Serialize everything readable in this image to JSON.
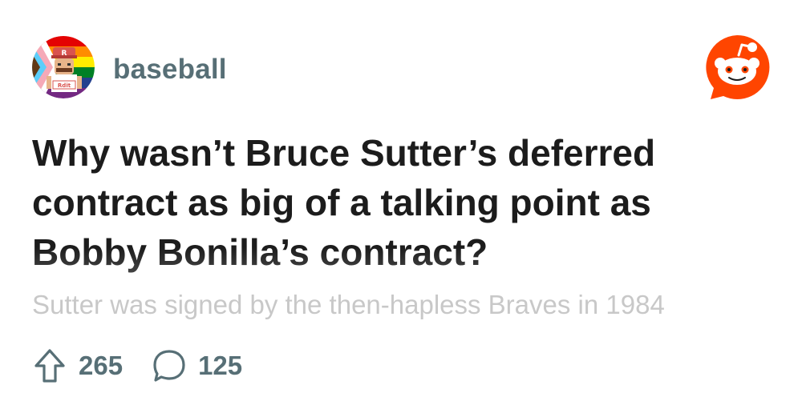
{
  "subreddit": {
    "name": "baseball",
    "avatar_icon": "subreddit-avatar-icon",
    "avatar_text": "Rdit"
  },
  "brand": {
    "logo_icon": "reddit-logo-icon",
    "accent_color": "#ff4500"
  },
  "post": {
    "title_lines": [
      "Why wasn’t Bruce Sutter’s deferred",
      "contract as big of a talking point as",
      "Bobby Bonilla’s contract?"
    ],
    "body_preview": "Sutter was signed by the then-hapless Braves in 1984"
  },
  "stats": {
    "upvotes": "265",
    "upvote_icon": "upvote-arrow-icon",
    "comments": "125",
    "comment_icon": "comment-bubble-icon"
  },
  "colors": {
    "title": "#1c1c1c",
    "meta": "#576f76",
    "body_preview": "#c8c8c8"
  }
}
